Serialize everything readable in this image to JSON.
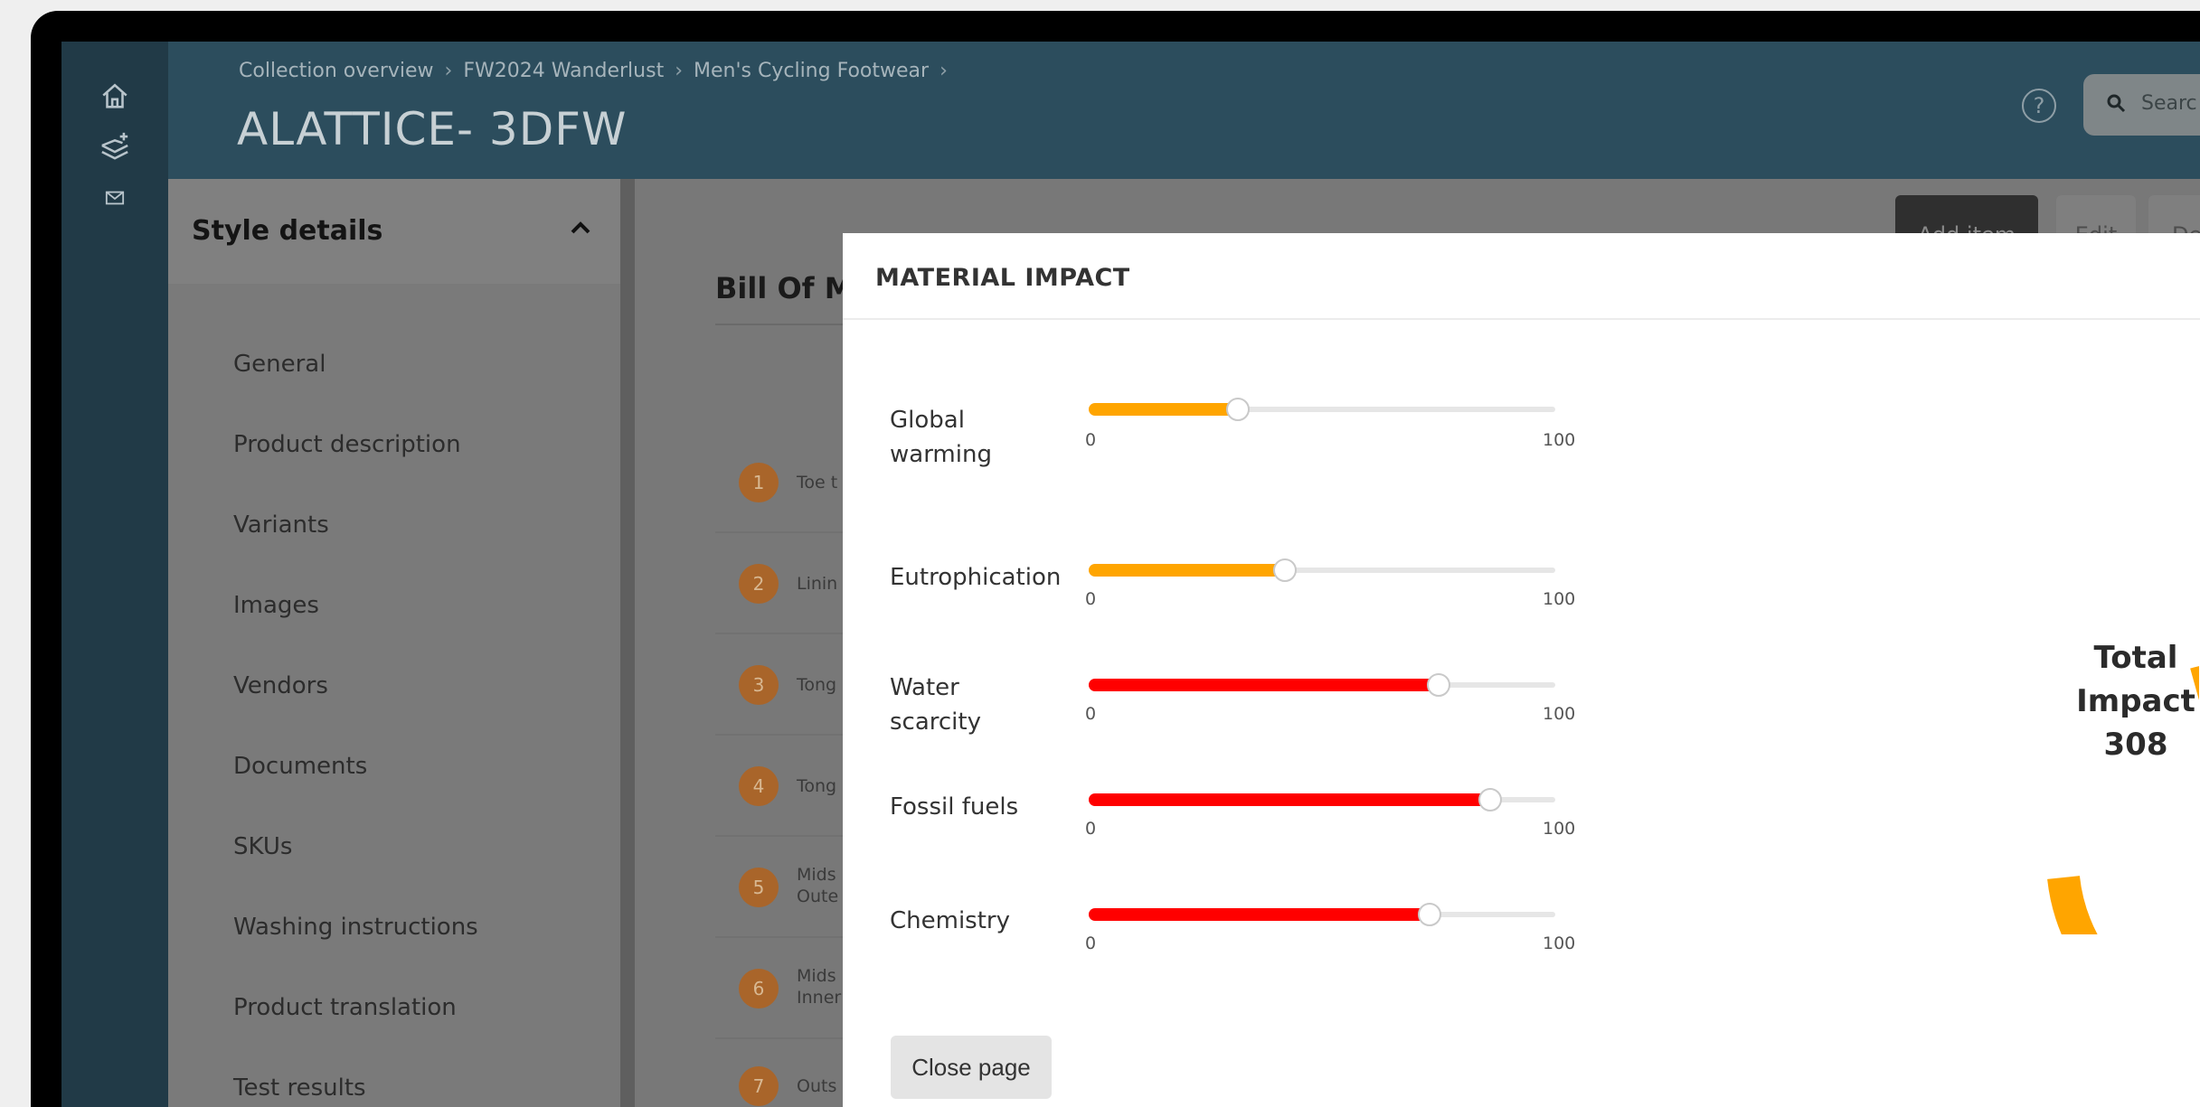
{
  "header": {
    "breadcrumbs": [
      "Collection overview",
      "FW2024 Wanderlust",
      "Men's Cycling Footwear"
    ],
    "title": "ALATTICE- 3DFW",
    "search_placeholder": "Searc"
  },
  "rail": {
    "icons": [
      "home-icon",
      "layers-add-icon",
      "mail-icon"
    ]
  },
  "sidebar": {
    "title": "Style details",
    "items": [
      {
        "label": "General"
      },
      {
        "label": "Product description"
      },
      {
        "label": "Variants"
      },
      {
        "label": "Images"
      },
      {
        "label": "Vendors"
      },
      {
        "label": "Documents"
      },
      {
        "label": "SKUs"
      },
      {
        "label": "Washing instructions"
      },
      {
        "label": "Product translation"
      },
      {
        "label": "Test results"
      }
    ]
  },
  "toolbar": {
    "add_item": "Add item",
    "edit": "Edit",
    "third": "De"
  },
  "bom": {
    "title": "Bill Of Ma",
    "rows": [
      {
        "num": "1",
        "text": "Toe t"
      },
      {
        "num": "2",
        "text": "Linin"
      },
      {
        "num": "3",
        "text": "Tong"
      },
      {
        "num": "4",
        "text": "Tong"
      },
      {
        "num": "5",
        "text": "Mids\nOute"
      },
      {
        "num": "6",
        "text": "Mids\nInner"
      },
      {
        "num": "7",
        "text": "Outs"
      }
    ]
  },
  "modal": {
    "title": "MATERIAL IMPACT",
    "range_min": "0",
    "range_max": "100",
    "metrics": [
      {
        "label": "Global\nwarming",
        "value": 32,
        "color": "#ffa500"
      },
      {
        "label": "Eutrophication",
        "value": 42,
        "color": "#ffa500"
      },
      {
        "label": "Water\nscarcity",
        "value": 75,
        "color": "#ff0000"
      },
      {
        "label": "Fossil fuels",
        "value": 86,
        "color": "#ff0000"
      },
      {
        "label": "Chemistry",
        "value": 73,
        "color": "#ff0000"
      }
    ],
    "total_label": "Total Impact",
    "total_value": "308",
    "donut_color": "#ffa500",
    "close_label": "Close page"
  }
}
